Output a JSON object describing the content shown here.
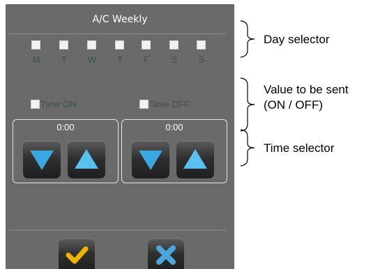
{
  "panel": {
    "title": "A/C Weekly",
    "days": [
      {
        "label": "M"
      },
      {
        "label": "T"
      },
      {
        "label": "W"
      },
      {
        "label": "T"
      },
      {
        "label": "F"
      },
      {
        "label": "S"
      },
      {
        "label": "S"
      }
    ],
    "time_on_label": "Time ON",
    "time_off_label": "Time OFF",
    "time_on_value": "0:00",
    "time_off_value": "0:00",
    "icons": {
      "down": "down-arrow-icon",
      "up": "up-arrow-icon",
      "confirm": "checkmark-icon",
      "cancel": "cross-icon"
    },
    "colors": {
      "panel_bg": "#6a6a6a",
      "label_text": "#3a5346",
      "arrow": "#3aa8e0",
      "confirm": "#f0b400",
      "cancel": "#4aa6dc"
    }
  },
  "annotations": {
    "day_selector": "Day selector",
    "value_line1": "Value to be sent",
    "value_line2": "(ON / OFF)",
    "time_selector": "Time selector"
  }
}
